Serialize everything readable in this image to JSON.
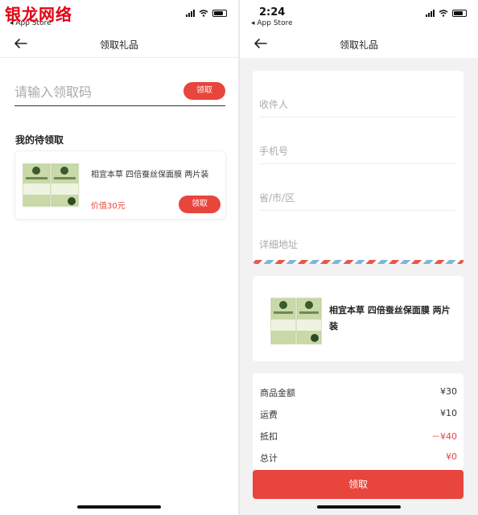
{
  "watermark": "银龙网络",
  "left": {
    "status": {
      "back_app": "◂ App Store"
    },
    "nav": {
      "title": "领取礼品"
    },
    "code_input": {
      "placeholder": "请输入领取码",
      "button": "领取"
    },
    "section_title": "我的待领取",
    "gift": {
      "name": "相宜本草 四倍蚕丝保面膜 两片装",
      "price": "价值30元",
      "button": "领取"
    }
  },
  "right": {
    "status": {
      "time": "2:24",
      "back_app": "◂ App Store"
    },
    "nav": {
      "title": "领取礼品"
    },
    "fields": [
      {
        "placeholder": "收件人"
      },
      {
        "placeholder": "手机号"
      },
      {
        "placeholder": "省/市/区"
      },
      {
        "placeholder": "详细地址"
      }
    ],
    "product": {
      "name": "相宜本草 四倍蚕丝保面膜 两片装"
    },
    "summary": [
      {
        "label": "商品金额",
        "value": "¥30"
      },
      {
        "label": "运费",
        "value": "¥10"
      },
      {
        "label": "抵扣",
        "value": "－¥40"
      },
      {
        "label": "总计",
        "value": "¥0"
      }
    ],
    "submit": "领取"
  },
  "colors": {
    "accent": "#e8453c",
    "watermark": "#e60012"
  },
  "icons": [
    "back-arrow-icon",
    "signal-icon",
    "wifi-icon",
    "battery-icon"
  ]
}
